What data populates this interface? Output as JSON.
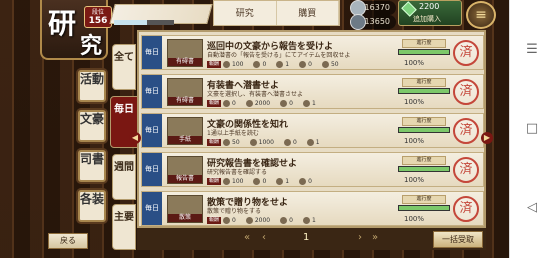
{
  "header": {
    "title_chars": [
      "研",
      "究"
    ],
    "level_label": "段位",
    "level": "156",
    "top_tabs": [
      "研究",
      "購買"
    ],
    "resources": [
      {
        "name": "silver-coin-icon",
        "value": "116370"
      },
      {
        "name": "ink-icon",
        "value": "13650"
      }
    ],
    "gems": "2200",
    "buy_label": "追加購入",
    "menu_icon": "menu-icon"
  },
  "side_menu": [
    {
      "label": "活動"
    },
    {
      "label": "文豪"
    },
    {
      "label": "司書"
    },
    {
      "label": "各装"
    }
  ],
  "back_label": "戻る",
  "categories": [
    {
      "label": "全て",
      "active": false
    },
    {
      "label": "毎日",
      "active": true
    },
    {
      "label": "週間",
      "active": false
    },
    {
      "label": "主要",
      "active": false
    }
  ],
  "tasks": [
    {
      "type": "毎日",
      "thumb_label": "有碍書",
      "title": "巡回中の文豪から報告を受けよ",
      "desc": "自動潜書の「報告を受ける」にてアイテムを回収せよ",
      "rewards": [
        {
          "tag": "報酬",
          "v": "100"
        },
        {
          "v": "0"
        },
        {
          "v": "1"
        },
        {
          "v": "0"
        },
        {
          "v": "50"
        }
      ],
      "progress_label": "進行度",
      "progress": 1.0,
      "progress_text": "100%",
      "stamp": "済"
    },
    {
      "type": "毎日",
      "thumb_label": "有碍書",
      "title": "有装書へ潜書せよ",
      "desc": "文豪を選択し、有装書へ潜書させよ",
      "rewards": [
        {
          "tag": "報酬",
          "v": "0"
        },
        {
          "v": "2000"
        },
        {
          "v": "0"
        },
        {
          "v": "1"
        }
      ],
      "progress_label": "進行度",
      "progress": 1.0,
      "progress_text": "100%",
      "stamp": "済"
    },
    {
      "type": "毎日",
      "thumb_label": "手紙",
      "title": "文豪の関係性を知れ",
      "desc": "1通以上手紙を読む",
      "rewards": [
        {
          "tag": "報酬",
          "v": "50"
        },
        {
          "v": "1000"
        },
        {
          "v": "0"
        },
        {
          "v": "1"
        }
      ],
      "progress_label": "進行度",
      "progress": 1.0,
      "progress_text": "100%",
      "stamp": "済"
    },
    {
      "type": "毎日",
      "thumb_label": "報告書",
      "title": "研究報告書を確認せよ",
      "desc": "研究報告書を確認する",
      "rewards": [
        {
          "tag": "報酬",
          "v": "100"
        },
        {
          "v": "0"
        },
        {
          "v": "1"
        },
        {
          "v": "0"
        }
      ],
      "progress_label": "進行度",
      "progress": 1.0,
      "progress_text": "100%",
      "stamp": "済"
    },
    {
      "type": "毎日",
      "thumb_label": "散策",
      "title": "散策で贈り物をせよ",
      "desc": "散策で贈り物をする",
      "rewards": [
        {
          "tag": "報酬",
          "v": "0"
        },
        {
          "v": "2000"
        },
        {
          "v": "0"
        },
        {
          "v": "1"
        }
      ],
      "progress_label": "進行度",
      "progress": 1.0,
      "progress_text": "100%",
      "stamp": "済"
    }
  ],
  "pager": [
    "«",
    "‹",
    "1",
    "›",
    "»"
  ],
  "claim_all_label": "一括受取"
}
